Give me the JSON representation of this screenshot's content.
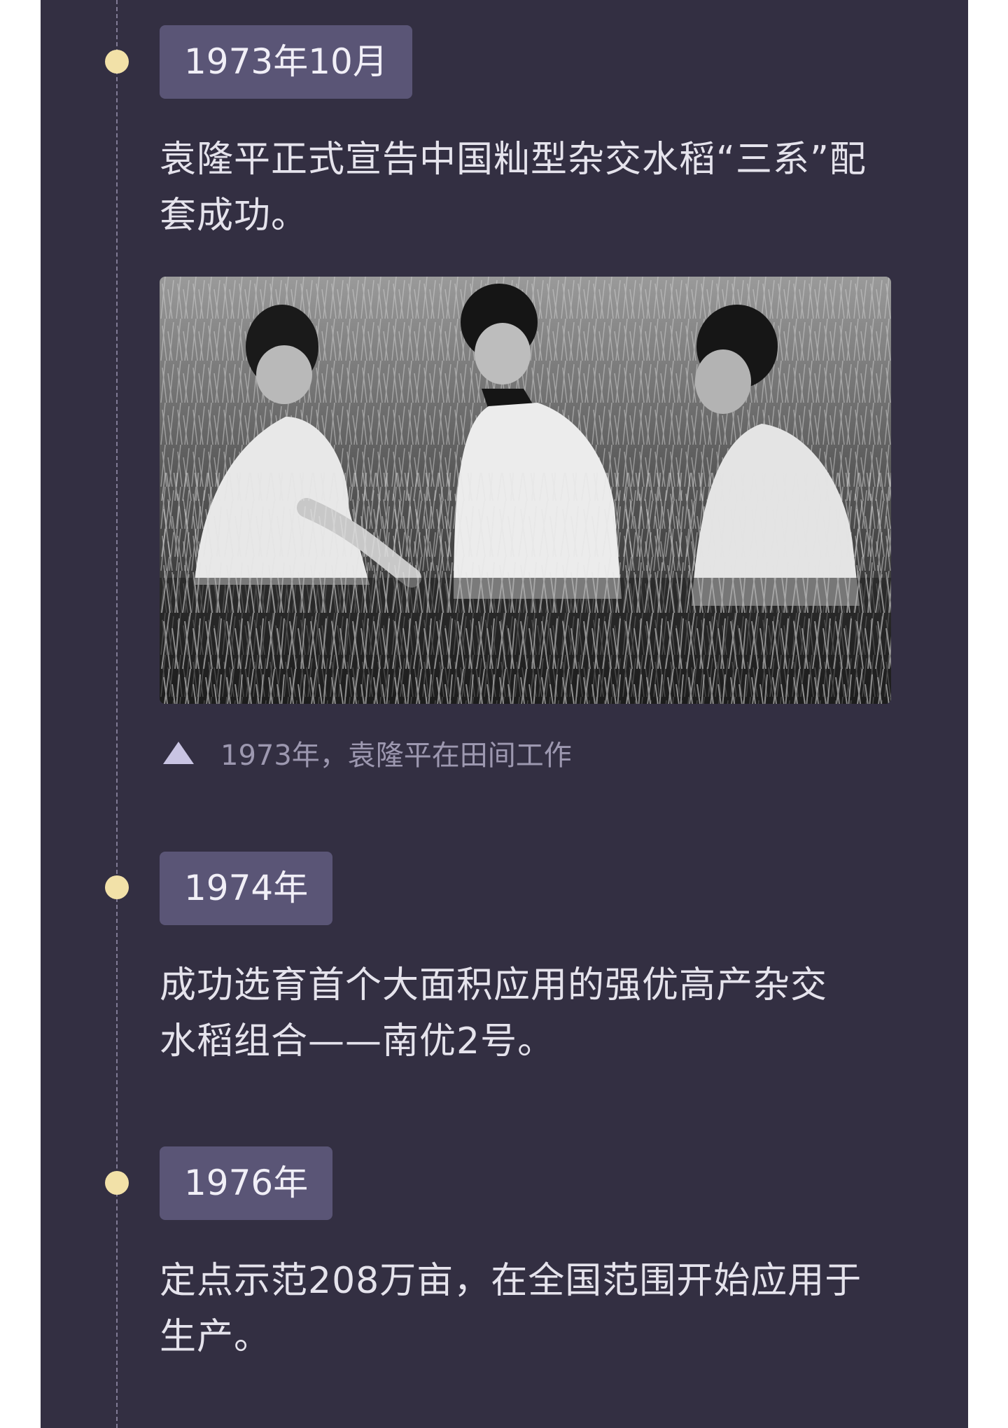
{
  "timeline": {
    "events": [
      {
        "date": "1973年10月",
        "description": "袁隆平正式宣告中国籼型杂交水稻“三系”配套成功。"
      },
      {
        "date": "1974年",
        "description": "成功选育首个大面积应用的强优高产杂交水稻组合——南优2号。"
      },
      {
        "date": "1976年",
        "description": "定点示范208万亩，在全国范围开始应用于生产。"
      }
    ],
    "photo": {
      "caption": "1973年，袁隆平在田间工作",
      "caption_icon": "triangle-up-icon"
    }
  },
  "colors": {
    "background": "#332f42",
    "badge": "#5a5576",
    "dot": "#f2e1a8",
    "text": "#e5e3ec",
    "caption": "#9d98b0"
  }
}
